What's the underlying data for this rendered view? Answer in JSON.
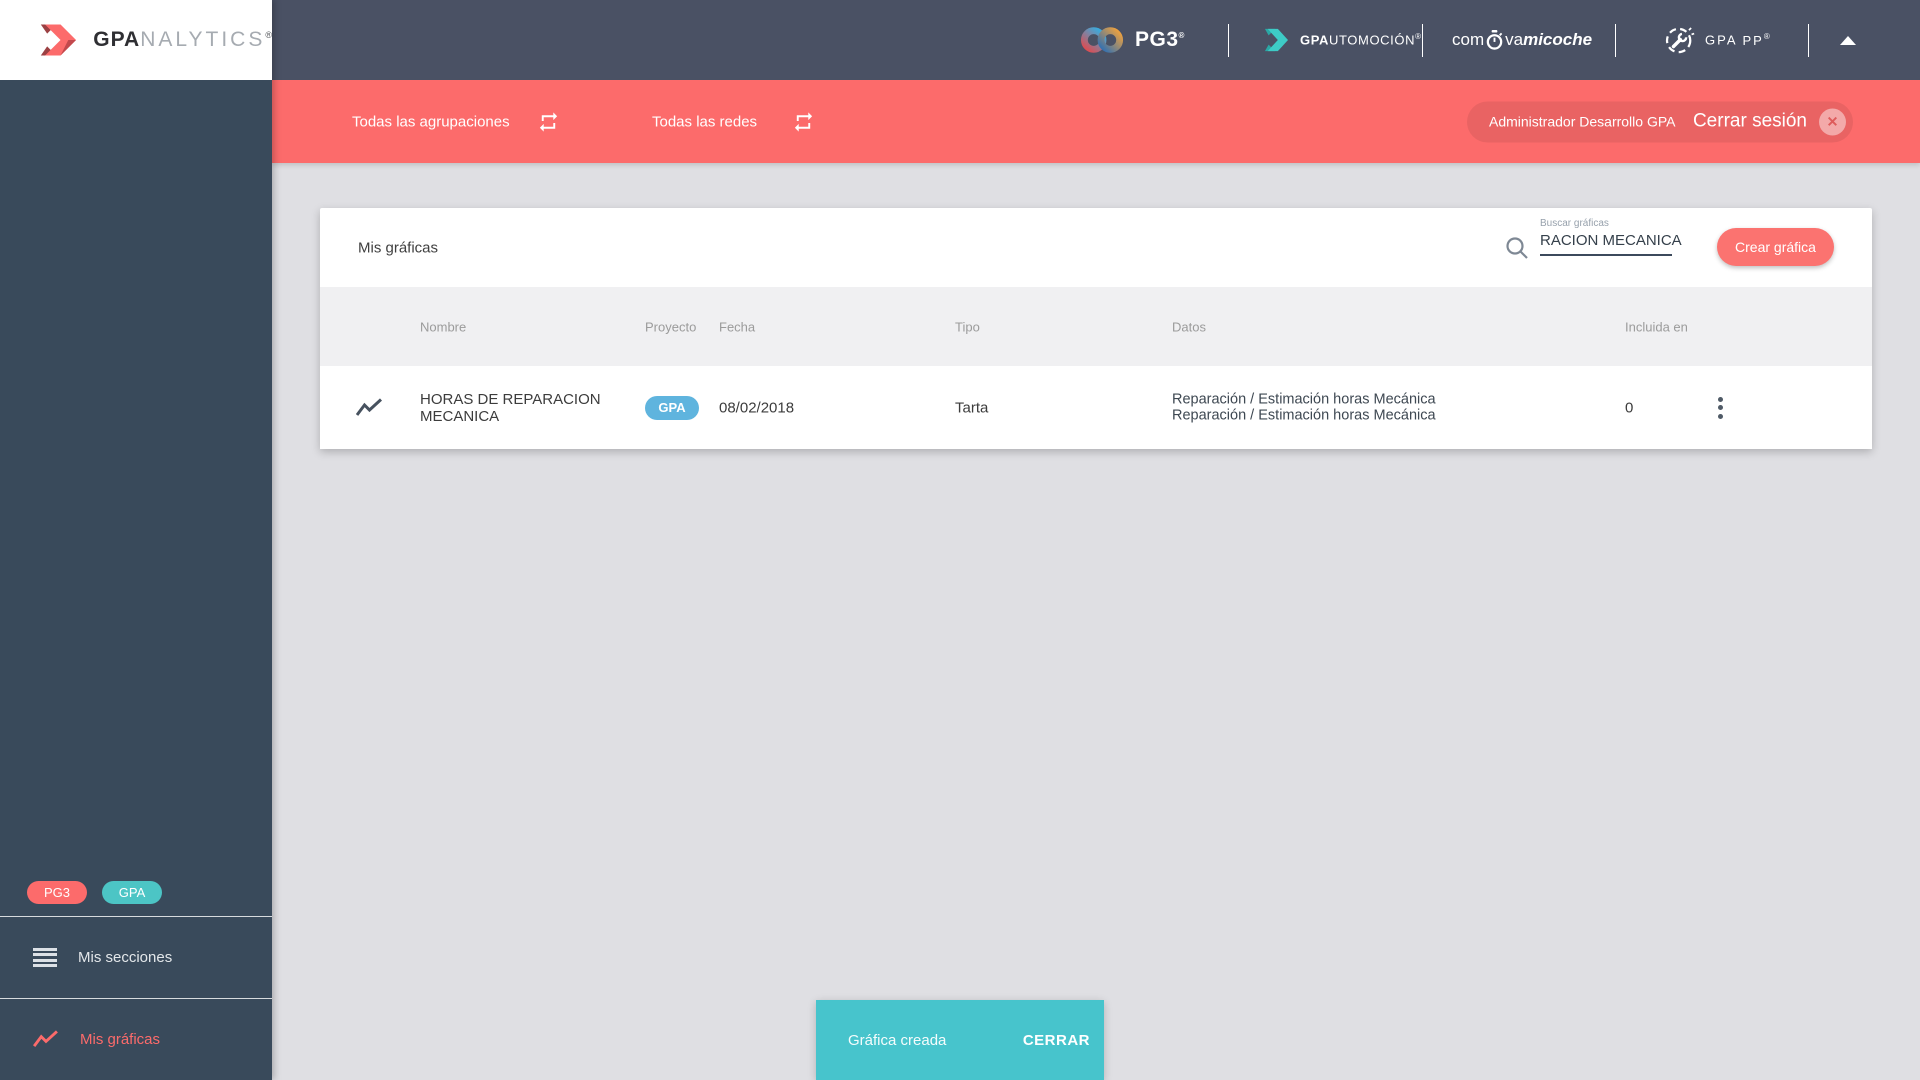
{
  "brand": {
    "logo_bold": "GPA",
    "logo_light": "NALYTICS",
    "mark": "®"
  },
  "topbar": {
    "pg3_label": "PG3",
    "pg3_mark": "®",
    "automocion_bold": "GPA",
    "automocion_rest": "UTOMOCIÓN",
    "automocion_mark": "®",
    "coche_pre": "com",
    "coche_mid": "va",
    "coche_italic": "micoche",
    "gpapp_part1": "GPA",
    "gpapp_part2": "PP",
    "gpapp_mark": "®"
  },
  "filterbar": {
    "groupings_label": "Todas las agrupaciones",
    "networks_label": "Todas las redes",
    "user_name": "Administrador Desarrollo GPA",
    "logout_label": "Cerrar sesión",
    "close_glyph": "✕"
  },
  "sidebar": {
    "badges": [
      {
        "label": "PG3",
        "color": "#FC6B6B"
      },
      {
        "label": "GPA",
        "color": "#4CC5C5"
      }
    ],
    "items": [
      {
        "label": "Mis secciones",
        "icon": "menu-icon",
        "active": false
      },
      {
        "label": "Mis gráficas",
        "icon": "chart-line-icon",
        "active": true
      }
    ]
  },
  "main": {
    "card": {
      "title": "Mis gráficas",
      "search": {
        "label": "Buscar gráficas",
        "value": "RACION MECANICA"
      },
      "create_button": "Crear gráfica",
      "table": {
        "headers": [
          "Nombre",
          "Proyecto",
          "Fecha",
          "Tipo",
          "Datos",
          "Incluida en"
        ],
        "rows": [
          {
            "name": "HORAS DE REPARACION MECANICA",
            "project": "GPA",
            "project_color": "#5FB4DE",
            "date": "08/02/2018",
            "type": "Tarta",
            "data_sources": [
              "Reparación / Estimación horas Mecánica",
              "Reparación / Estimación horas Mecánica"
            ],
            "included_in": "0"
          }
        ]
      }
    },
    "snackbar": {
      "message": "Gráfica creada",
      "action": "CERRAR",
      "color": "#47C4CC"
    }
  },
  "colors": {
    "accent_red": "#FC6B6B",
    "topbar": "#4A5164",
    "sidebar": "#394A5B",
    "teal": "#47C4CC",
    "badge_blue": "#5FB4DE",
    "background": "#DFDFE3",
    "table_header_bg": "#F0F0F2"
  }
}
